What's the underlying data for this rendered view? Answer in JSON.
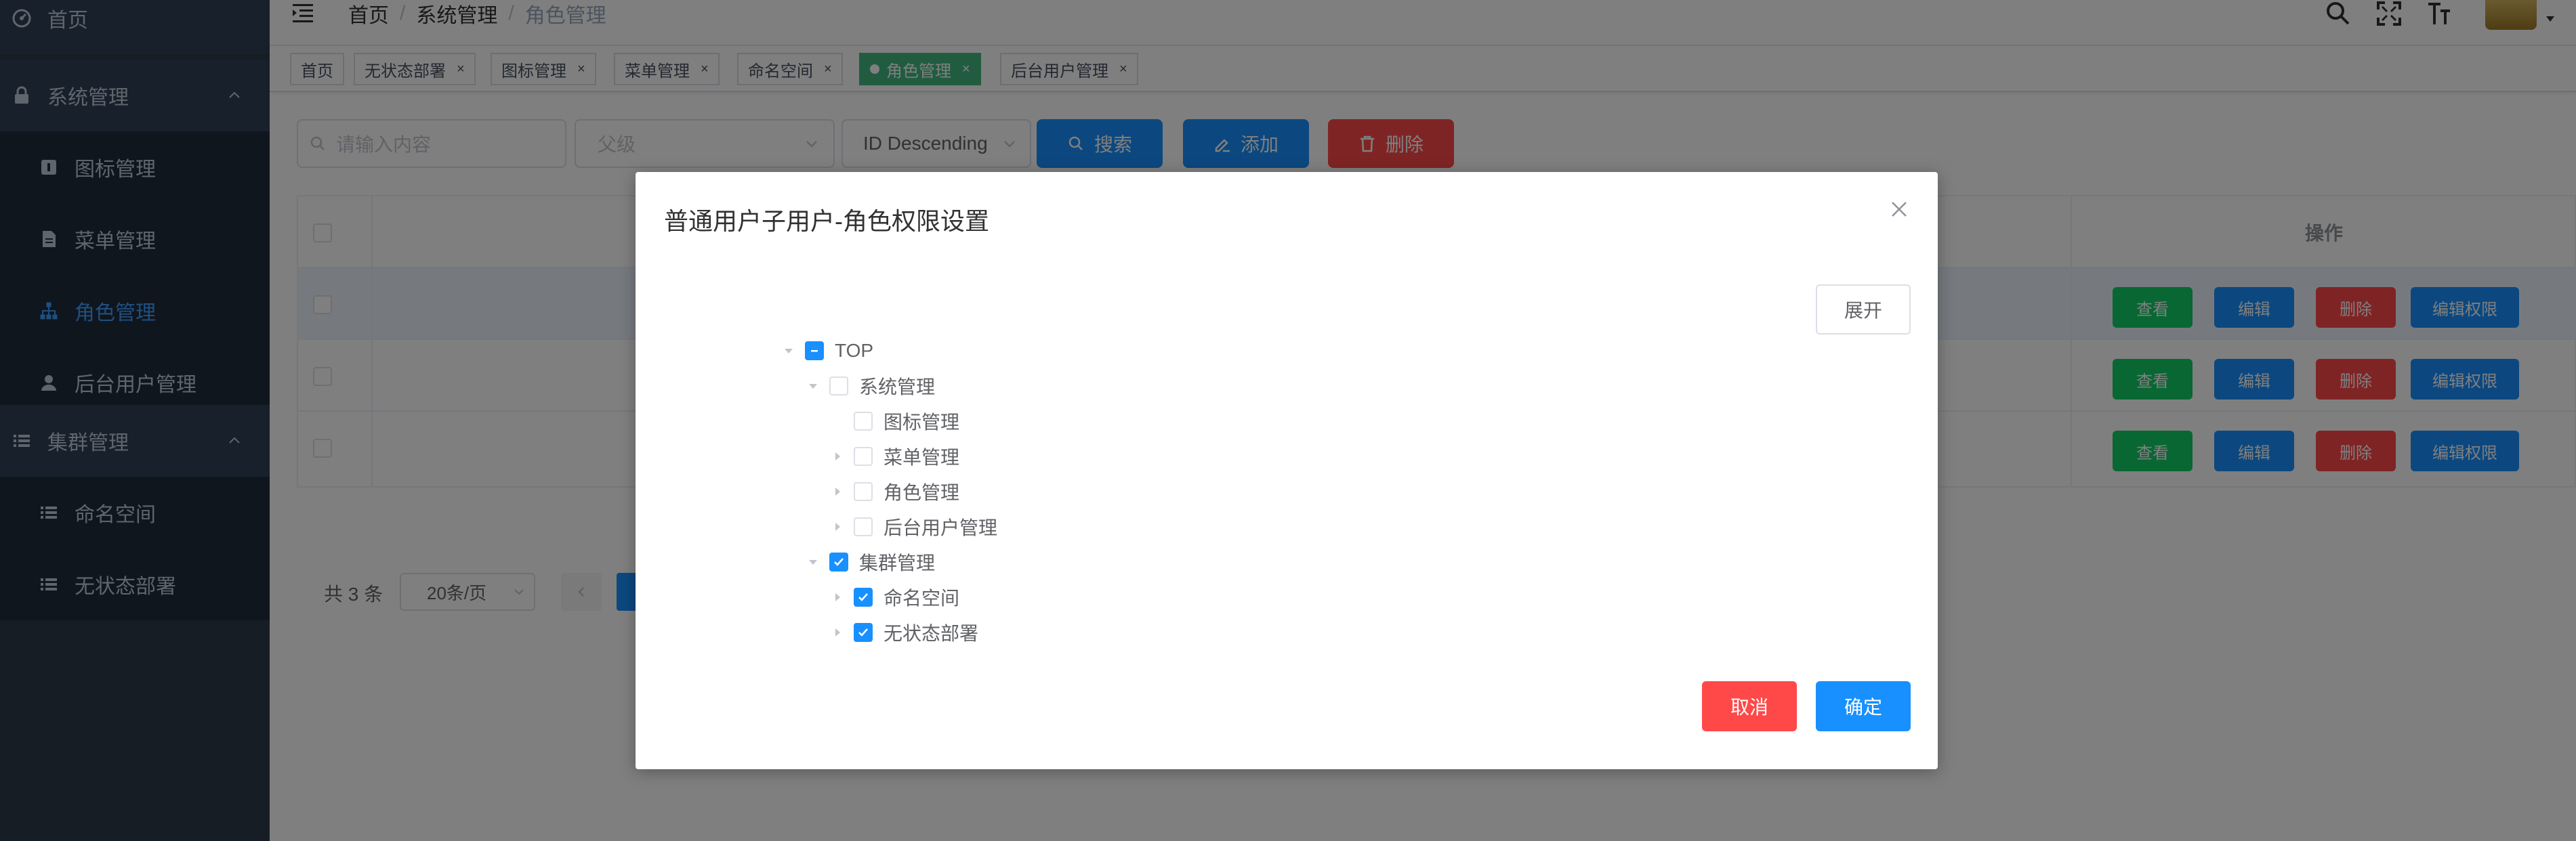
{
  "sidebar": {
    "items": [
      {
        "label": "首页",
        "icon": "dashboard-icon"
      },
      {
        "label": "系统管理",
        "icon": "lock-icon",
        "expanded": true
      },
      {
        "label": "图标管理",
        "icon": "icon-manage-icon"
      },
      {
        "label": "菜单管理",
        "icon": "document-icon"
      },
      {
        "label": "角色管理",
        "icon": "tree-icon",
        "active": true
      },
      {
        "label": "后台用户管理",
        "icon": "user-icon"
      },
      {
        "label": "集群管理",
        "icon": "list-icon",
        "expanded": true
      },
      {
        "label": "命名空间",
        "icon": "list-icon"
      },
      {
        "label": "无状态部署",
        "icon": "list-icon"
      }
    ],
    "active_color": "#409eff",
    "bg_color": "#304156"
  },
  "navbar": {
    "breadcrumb": [
      "首页",
      "系统管理",
      "角色管理"
    ],
    "separator": "/"
  },
  "tags": [
    {
      "label": "首页",
      "closable": false
    },
    {
      "label": "无状态部署",
      "closable": true
    },
    {
      "label": "图标管理",
      "closable": true
    },
    {
      "label": "菜单管理",
      "closable": true
    },
    {
      "label": "命名空间",
      "closable": true
    },
    {
      "label": "角色管理",
      "closable": true,
      "active": true
    },
    {
      "label": "后台用户管理",
      "closable": true
    }
  ],
  "tag_close": "×",
  "filters": {
    "search_placeholder": "请输入内容",
    "parent_placeholder": "父级",
    "sort_value": "ID Descending",
    "search_label": "搜索",
    "add_label": "添加",
    "delete_label": "删除"
  },
  "table": {
    "header_action": "操作",
    "rows": 3,
    "actions": {
      "view": "查看",
      "edit": "编辑",
      "delete": "删除",
      "edit_perm": "编辑权限"
    }
  },
  "pagination": {
    "total": "共 3 条",
    "page_size": "20条/页"
  },
  "dialog": {
    "title": "普通用户子用户-角色权限设置",
    "expand_label": "展开",
    "cancel_label": "取消",
    "confirm_label": "确定",
    "tree": [
      {
        "label": "TOP",
        "level": 0,
        "state": "indeterminate",
        "caret": "down"
      },
      {
        "label": "系统管理",
        "level": 1,
        "state": "unchecked",
        "caret": "down"
      },
      {
        "label": "图标管理",
        "level": 2,
        "state": "unchecked",
        "caret": "none"
      },
      {
        "label": "菜单管理",
        "level": 2,
        "state": "unchecked",
        "caret": "right"
      },
      {
        "label": "角色管理",
        "level": 2,
        "state": "unchecked",
        "caret": "right"
      },
      {
        "label": "后台用户管理",
        "level": 2,
        "state": "unchecked",
        "caret": "right"
      },
      {
        "label": "集群管理",
        "level": 1,
        "state": "checked",
        "caret": "down"
      },
      {
        "label": "命名空间",
        "level": 2,
        "state": "checked",
        "caret": "right"
      },
      {
        "label": "无状态部署",
        "level": 2,
        "state": "checked",
        "caret": "right"
      }
    ]
  },
  "colors": {
    "primary": "#1890ff",
    "danger": "#ff4949",
    "success": "#13ce66",
    "tag_active": "#42b983"
  }
}
